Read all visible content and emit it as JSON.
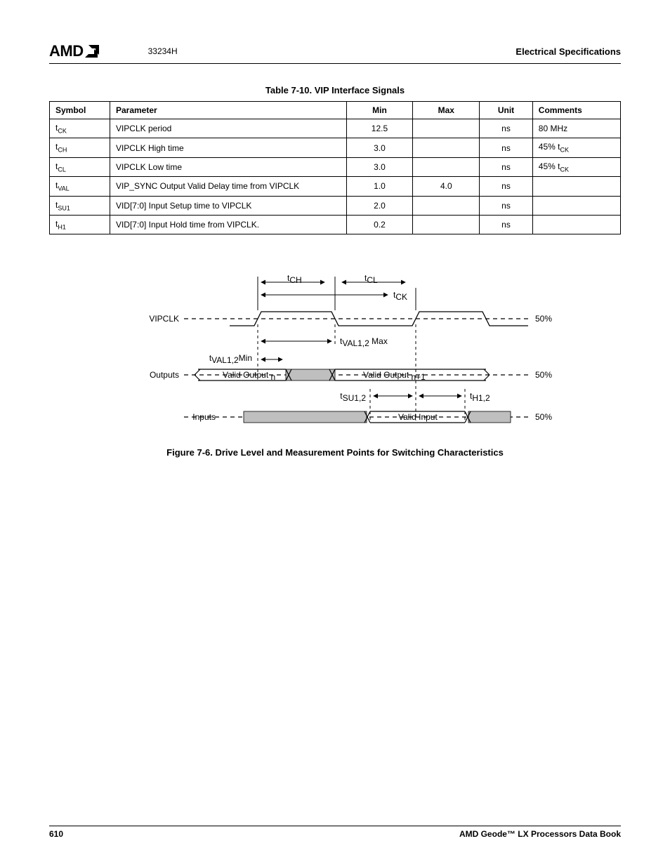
{
  "header": {
    "logo_text": "AMD",
    "doc_number": "33234H",
    "section": "Electrical Specifications"
  },
  "table": {
    "caption": "Table 7-10.  VIP Interface Signals",
    "headers": {
      "symbol": "Symbol",
      "parameter": "Parameter",
      "min": "Min",
      "max": "Max",
      "unit": "Unit",
      "comments": "Comments"
    },
    "rows": [
      {
        "sym_base": "t",
        "sym_sub": "CK",
        "param": "VIPCLK period",
        "min": "12.5",
        "max": "",
        "unit": "ns",
        "comment_plain": "80 MHz",
        "comment_has_sub": false
      },
      {
        "sym_base": "t",
        "sym_sub": "CH",
        "param": "VIPCLK High time",
        "min": "3.0",
        "max": "",
        "unit": "ns",
        "comment_prefix": "45% t",
        "comment_sub": "CK",
        "comment_has_sub": true
      },
      {
        "sym_base": "t",
        "sym_sub": "CL",
        "param": "VIPCLK Low time",
        "min": "3.0",
        "max": "",
        "unit": "ns",
        "comment_prefix": "45% t",
        "comment_sub": "CK",
        "comment_has_sub": true
      },
      {
        "sym_base": "t",
        "sym_sub": "VAL",
        "param": "VIP_SYNC Output Valid Delay time from VIPCLK",
        "min": "1.0",
        "max": "4.0",
        "unit": "ns",
        "comment_plain": "",
        "comment_has_sub": false
      },
      {
        "sym_base": "t",
        "sym_sub": "SU1",
        "param": "VID[7:0] Input Setup time to VIPCLK",
        "min": "2.0",
        "max": "",
        "unit": "ns",
        "comment_plain": "",
        "comment_has_sub": false
      },
      {
        "sym_base": "t",
        "sym_sub": "H1",
        "param": "VID[7:0] Input Hold time from VIPCLK.",
        "min": "0.2",
        "max": "",
        "unit": "ns",
        "comment_plain": "",
        "comment_has_sub": false
      }
    ]
  },
  "figure": {
    "caption": "Figure 7-6.  Drive Level and Measurement Points for Switching Characteristics",
    "labels": {
      "vipclk": "VIPCLK",
      "outputs": "Outputs",
      "inputs": "Inputs",
      "fifty": "50%",
      "t_ch": "t",
      "t_ch_sub": "CH",
      "t_cl": "t",
      "t_cl_sub": "CL",
      "t_ck": "t",
      "t_ck_sub": "CK",
      "t_val_min_pre": "t",
      "t_val_min_sub": "VAL1,2",
      "t_val_min_post": "Min",
      "t_val_max_pre": "t",
      "t_val_max_sub": "VAL1,2",
      "t_val_max_post": " Max",
      "t_su_pre": "t",
      "t_su_sub": "SU1,2",
      "t_h_pre": "t",
      "t_h_sub": "H1,2",
      "valid_out_pre": "Valid Output ",
      "valid_out_n": "n",
      "valid_out_np1_pre": "Valid Output ",
      "valid_out_np1": "n+1",
      "valid_input": "Valid Input"
    }
  },
  "footer": {
    "page": "610",
    "book": "AMD Geode™ LX Processors Data Book"
  }
}
